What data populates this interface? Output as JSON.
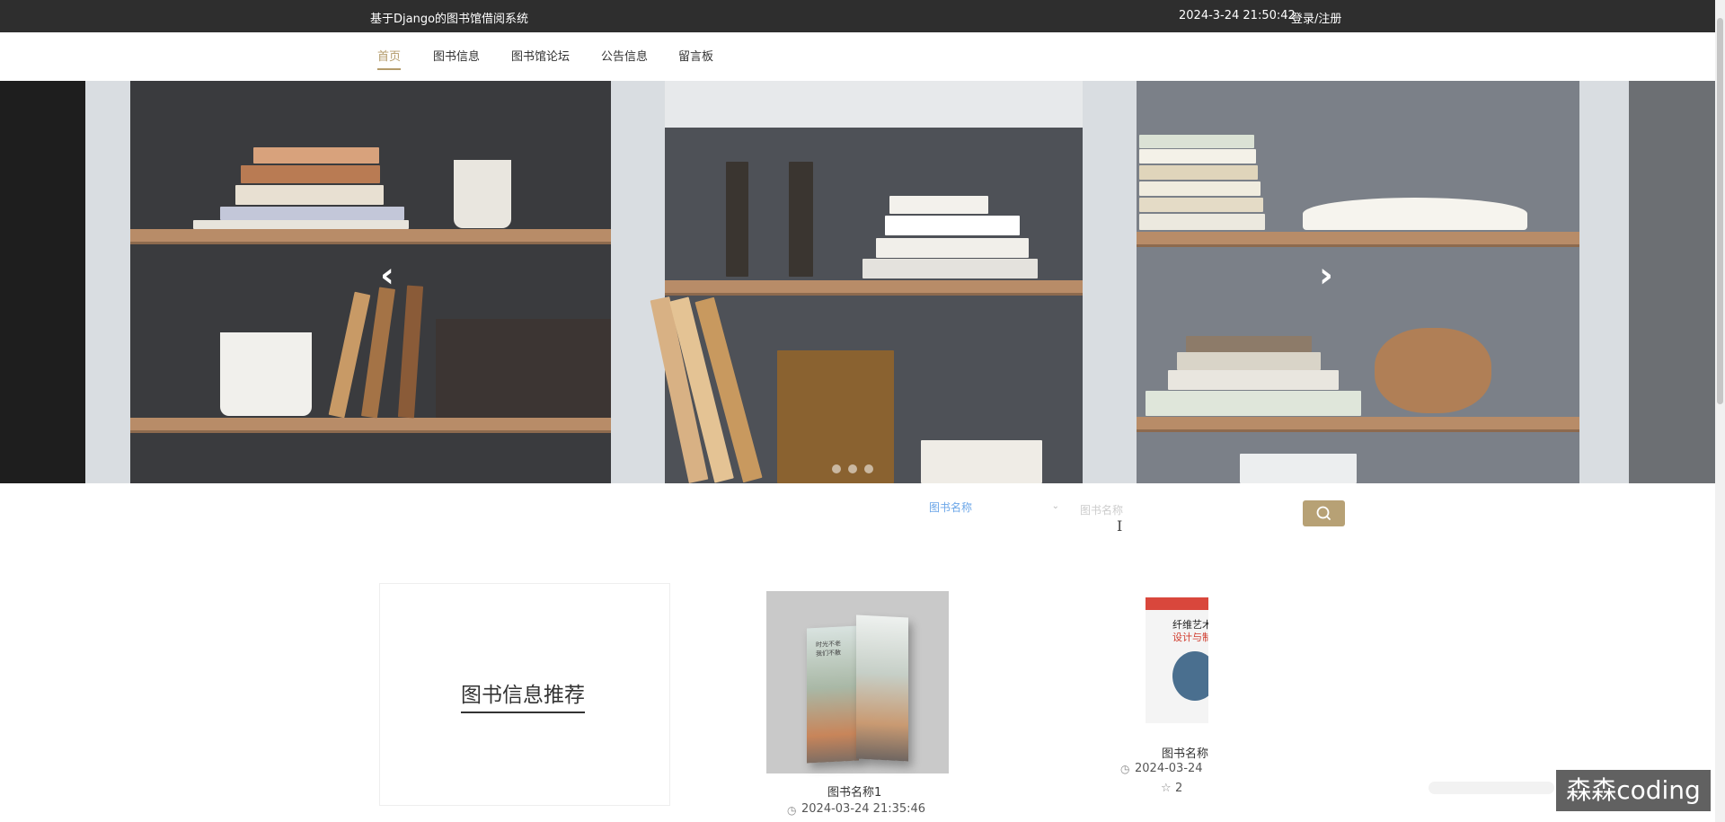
{
  "topbar": {
    "site_title": "基于Django的图书馆借阅系统",
    "clock": "2024-3-24 21:50:42",
    "login_link": "登录/注册"
  },
  "nav": {
    "items": [
      {
        "label": "首页",
        "active": true
      },
      {
        "label": "图书信息"
      },
      {
        "label": "图书馆论坛"
      },
      {
        "label": "公告信息"
      },
      {
        "label": "留言板"
      }
    ]
  },
  "banner": {
    "prev_icon": "chevron-left-icon",
    "next_icon": "chevron-right-icon",
    "slide_count": 3,
    "active_slide": 1
  },
  "search": {
    "field_select": "图书名称",
    "placeholder": "图书名称",
    "button_icon": "search-icon"
  },
  "recommend": {
    "title": "图书信息推荐"
  },
  "books": [
    {
      "name": "图书名称1",
      "time": "2024-03-24 21:35:46",
      "cover_text": [
        "时光不老",
        "我们不散"
      ]
    },
    {
      "name": "图书名称",
      "time": "2024-03-24",
      "likes": "2",
      "cover_text": [
        "纤维艺术",
        "设计与制作"
      ]
    }
  ],
  "watermark": "森森coding",
  "colors": {
    "topbar_bg": "#2e2e2e",
    "accent": "#b49b6b",
    "search_button": "#b7a175",
    "select_text": "#6ba6e8"
  }
}
